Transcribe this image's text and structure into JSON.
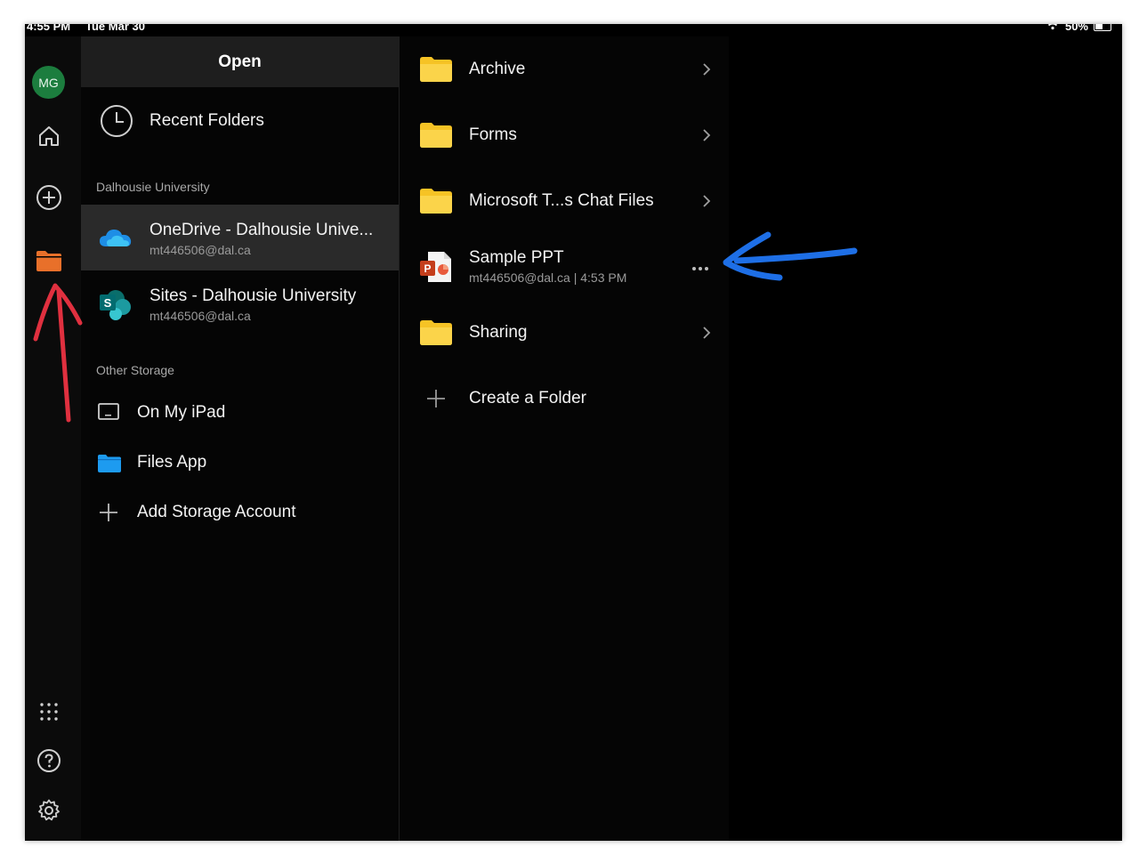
{
  "status_bar": {
    "time": "4:55 PM",
    "date": "Tue Mar 30",
    "battery": "50%"
  },
  "rail": {
    "avatar_initials": "MG",
    "avatar_color": "#1c7d3e",
    "icons": [
      "home-icon",
      "add-icon",
      "folder-icon",
      "apps-grid-icon",
      "help-icon",
      "settings-icon"
    ],
    "active_color": "#e8702a"
  },
  "sidebar": {
    "title": "Open",
    "recent": "Recent Folders",
    "section_dal": "Dalhousie University",
    "accounts": [
      {
        "title": "OneDrive - Dalhousie Unive...",
        "subtitle": "mt446506@dal.ca"
      },
      {
        "title": "Sites - Dalhousie University",
        "subtitle": "mt446506@dal.ca"
      }
    ],
    "section_other": "Other Storage",
    "storage": [
      {
        "label": "On My iPad"
      },
      {
        "label": "Files App"
      },
      {
        "label": "Add Storage Account"
      }
    ]
  },
  "list": {
    "items": [
      {
        "name": "Archive",
        "type": "folder"
      },
      {
        "name": "Forms",
        "type": "folder"
      },
      {
        "name": "Microsoft T...s Chat Files",
        "type": "folder"
      },
      {
        "name": "Sample PPT",
        "type": "pptx",
        "meta": "mt446506@dal.ca | 4:53 PM"
      },
      {
        "name": "Sharing",
        "type": "folder"
      }
    ],
    "create_folder": "Create a Folder"
  },
  "colors": {
    "folder": "#f6c325",
    "blue_annotation": "#1e6fe6",
    "red_annotation": "#e0303f"
  }
}
